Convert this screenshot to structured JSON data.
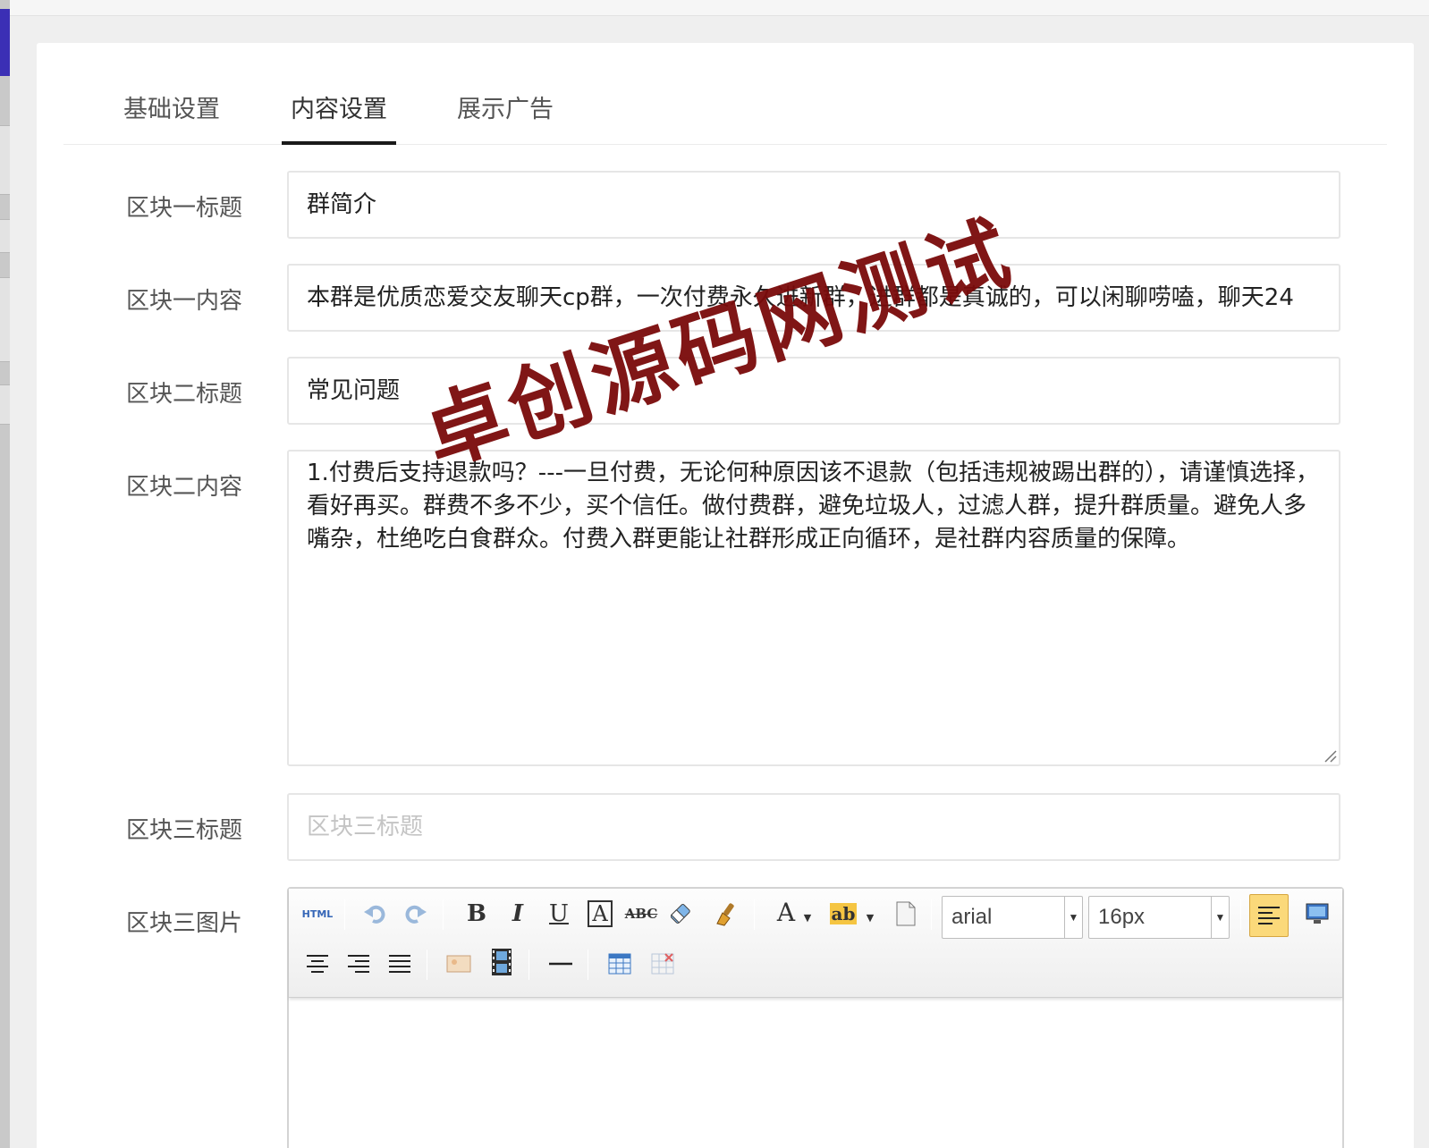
{
  "tabs": [
    {
      "label": "基础设置"
    },
    {
      "label": "内容设置"
    },
    {
      "label": "展示广告"
    }
  ],
  "form": {
    "block1_title": {
      "label": "区块一标题",
      "value": "群简介"
    },
    "block1_content": {
      "label": "区块一内容",
      "value": "本群是优质恋爱交友聊天cp群，一次付费永久进新群，进群都是真诚的，可以闲聊唠嗑，聊天24"
    },
    "block2_title": {
      "label": "区块二标题",
      "value": "常见问题"
    },
    "block2_content": {
      "label": "区块二内容",
      "value": "1.付费后支持退款吗？---一旦付费，无论何种原因该不退款（包括违规被踢出群的），请谨慎选择，看好再买。群费不多不少，买个信任。做付费群，避免垃圾人，过滤人群，提升群质量。避免人多嘴杂，杜绝吃白食群众。付费入群更能让社群形成正向循环，是社群内容质量的保障。"
    },
    "block3_title": {
      "label": "区块三标题",
      "placeholder": "区块三标题",
      "value": ""
    },
    "block3_image": {
      "label": "区块三图片"
    }
  },
  "editor": {
    "toolbar_row1": [
      "html-icon",
      "undo-icon",
      "redo-icon",
      "bold-icon",
      "italic-icon",
      "underline-icon",
      "font-border-icon",
      "strikethrough-icon",
      "eraser-icon",
      "format-brush-icon",
      "font-color-icon",
      "highlight-icon",
      "paste-icon"
    ],
    "toolbar_row2": [
      "align-center-icon",
      "align-right-icon",
      "align-justify-icon",
      "image-icon",
      "video-icon",
      "horizontal-rule-icon",
      "insert-table-icon",
      "delete-table-icon"
    ],
    "html_label": "HTML",
    "bold_label": "B",
    "italic_label": "I",
    "underline_label": "U",
    "font_border_label": "A",
    "strike_label": "ABC",
    "font_color_label": "A",
    "highlight_label": "ab",
    "font_family": "arial",
    "font_size": "16px"
  },
  "watermark": "卓创源码网测试",
  "colors": {
    "accent": "#3b2fb5",
    "watermark": "#7a0a0a",
    "active_tab_underline": "#1a1a1a",
    "align_left_active": "#fbd97a"
  }
}
